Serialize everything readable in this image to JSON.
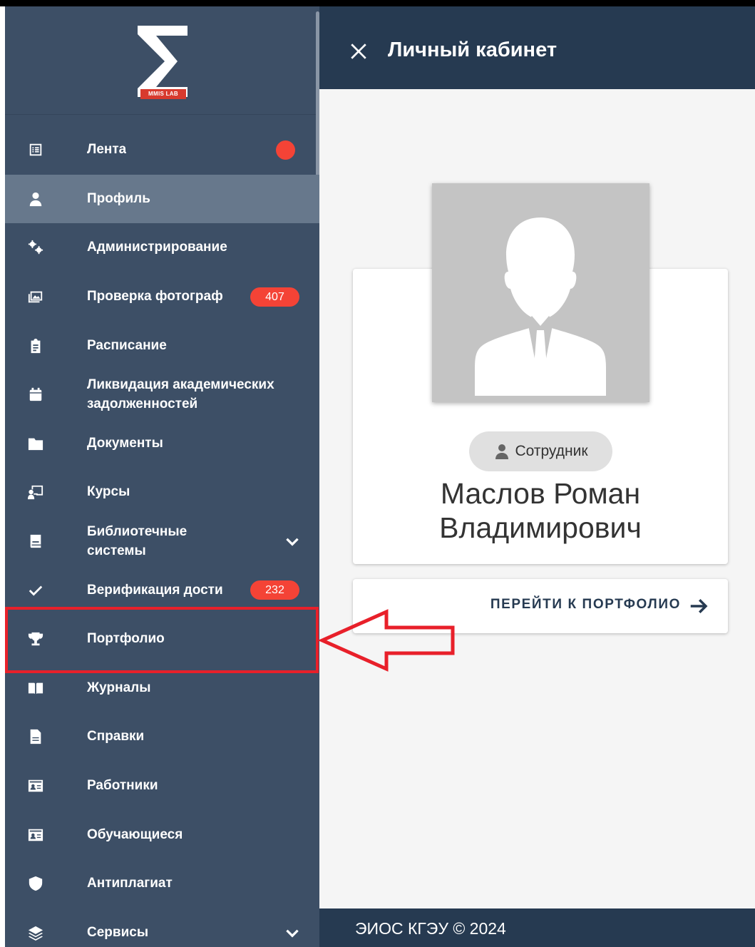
{
  "logo": {
    "mark": "M",
    "text": "MMIS LAB"
  },
  "sidebar": {
    "items": [
      {
        "label": "Лента",
        "icon": "list-icon",
        "dot": true
      },
      {
        "label": "Профиль",
        "icon": "person-icon",
        "active": true
      },
      {
        "label": "Администрирование",
        "icon": "gears-icon"
      },
      {
        "label": "Проверка фотограф",
        "icon": "photo-icon",
        "badge": "407"
      },
      {
        "label": "Расписание",
        "icon": "clipboard-icon"
      },
      {
        "label": "Ликвидация академических задолженностей",
        "icon": "calendar-icon"
      },
      {
        "label": "Документы",
        "icon": "folder-icon"
      },
      {
        "label": "Курсы",
        "icon": "teacher-board-icon"
      },
      {
        "label": "Библиотечные системы",
        "icon": "book-icon",
        "expandable": true
      },
      {
        "label": "Верификация дости",
        "icon": "check-icon",
        "badge": "232"
      },
      {
        "label": "Портфолио",
        "icon": "trophy-icon"
      },
      {
        "label": "Журналы",
        "icon": "open-book-icon"
      },
      {
        "label": "Справки",
        "icon": "document-icon"
      },
      {
        "label": "Работники",
        "icon": "id-card-icon"
      },
      {
        "label": "Обучающиеся",
        "icon": "id-card-icon"
      },
      {
        "label": "Антиплагиат",
        "icon": "shield-icon"
      },
      {
        "label": "Сервисы",
        "icon": "layers-icon",
        "expandable": true
      }
    ]
  },
  "header": {
    "title": "Личный кабинет"
  },
  "profile": {
    "role": "Сотрудник",
    "name": "Маслов Роман Владимирович",
    "portfolio_button": "ПЕРЕЙТИ К ПОРТФОЛИО"
  },
  "footer": {
    "text": "ЭИОС КГЭУ © 2024"
  },
  "colors": {
    "sidebar": "#3d4f66",
    "header": "#263a51",
    "badge": "#f44336",
    "highlight": "#e8202a"
  }
}
